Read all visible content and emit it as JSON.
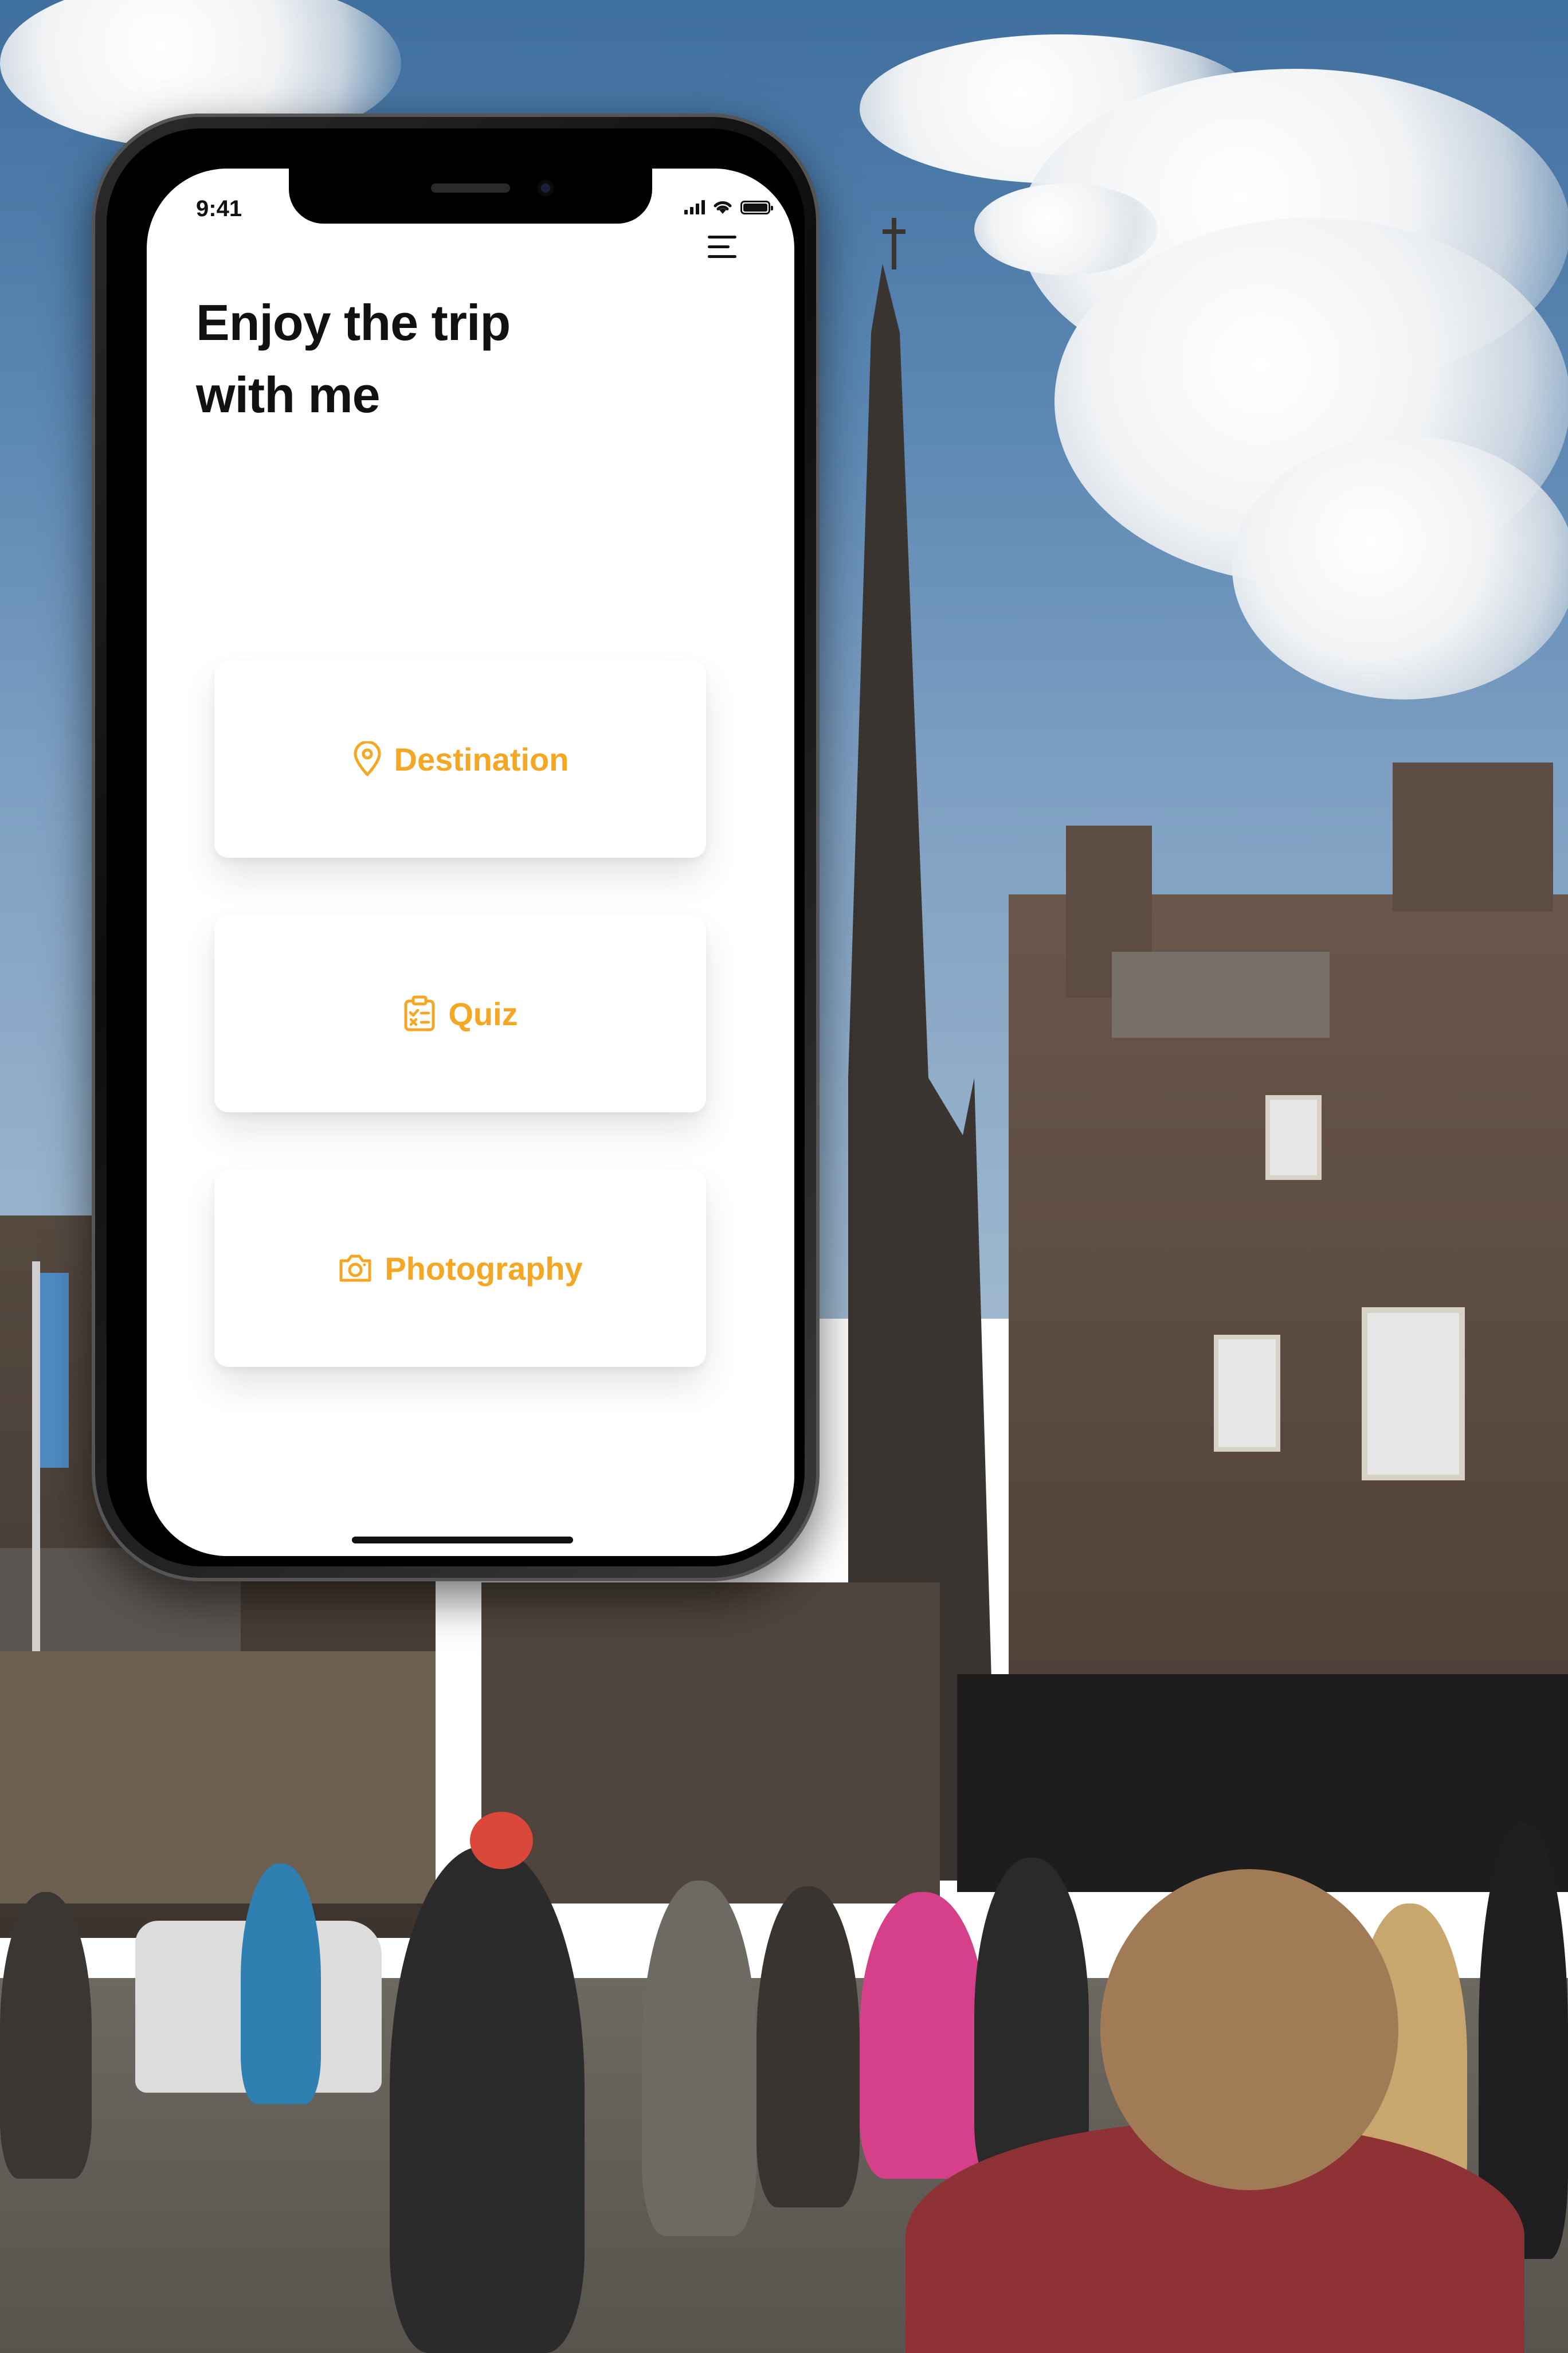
{
  "status_bar": {
    "time": "9:41"
  },
  "header": {
    "title_line1": "Enjoy the trip",
    "title_line2": "with me",
    "menu_icon": "hamburger-menu-icon"
  },
  "cards": [
    {
      "label": "Destination",
      "icon": "map-pin-icon"
    },
    {
      "label": "Quiz",
      "icon": "clipboard-checklist-icon"
    },
    {
      "label": "Photography",
      "icon": "camera-icon"
    }
  ],
  "colors": {
    "accent": "#f5a623",
    "text": "#111111",
    "card_bg": "#ffffff"
  }
}
